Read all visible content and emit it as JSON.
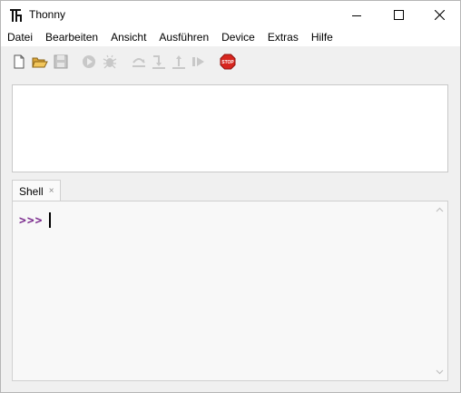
{
  "window": {
    "title": "Thonny"
  },
  "menu": [
    "Datei",
    "Bearbeiten",
    "Ansicht",
    "Ausführen",
    "Device",
    "Extras",
    "Hilfe"
  ],
  "toolbar": {
    "buttons": [
      "new-file",
      "open-file",
      "save-file",
      "run",
      "debug",
      "step-over",
      "step-into",
      "step-out",
      "resume",
      "stop"
    ],
    "stop_label": "STOP"
  },
  "tabs": {
    "shell_label": "Shell",
    "close_glyph": "×"
  },
  "shell": {
    "prompt": ">>>"
  },
  "colors": {
    "prompt": "#7b2c8e",
    "stop": "#d7261e"
  }
}
